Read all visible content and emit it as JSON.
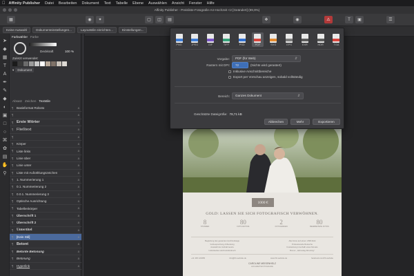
{
  "menubar": {
    "app_name": "Affinity Publisher",
    "items": [
      "Datei",
      "Bearbeiten",
      "Dokument",
      "Text",
      "Tabelle",
      "Ebene",
      "Auswählen",
      "Ansicht",
      "Fenster",
      "Hilfe"
    ]
  },
  "window": {
    "title": "Affinity Publisher - Preisliste-Fotografie-A4-Hochzeit <2 [Geändert] (99,9%)"
  },
  "context_toolbar": {
    "buttons": [
      "Keine Auswahl",
      "Dokumenteinstellungen...",
      "Layoutstile einrichten...",
      "Einstellungen..."
    ]
  },
  "color_panel": {
    "tabs": [
      "Farbwähler",
      "Farbe"
    ],
    "opacity_label": "Deckkraft",
    "opacity_value": "100 %",
    "recent_label": "Zuletzt verwendet:",
    "document_label": "Dokument",
    "recent_colors": [
      "#1b1b1b",
      "#3a3a3a",
      "#6b6b6b",
      "#9b9b9b",
      "#c8c8c8",
      "#ffffff",
      "#b8a99a",
      "#7f7268",
      "#c9c2ba",
      "#dedad4"
    ]
  },
  "text_styles_panel": {
    "tabs": [
      "Absatz",
      "Zeichen",
      "Textstile"
    ],
    "styles": [
      "Basisformat Roboto",
      "",
      "Erste Wörter",
      "Fließtext",
      "",
      "Körper",
      "Liste links",
      "Linie über",
      "Linie unter",
      "Liste mit Aufzählungszeichen",
      "1. Nummerierung 1",
      "0.1. Nummerierung 2",
      "0.0.1. Nummerierung 3",
      "Optische Ausrichtung",
      "Tabellenkörper",
      "Überschrift 1",
      "Überschrift 2",
      "Untertitel",
      "[Kein Stil]",
      "Betont",
      "Betonte Betonung",
      "Betonung",
      "Hyperlink"
    ],
    "selected_index": 18
  },
  "export_dialog": {
    "formats": [
      "PNG",
      "JPEG",
      "GIF",
      "TIFF",
      "PSD",
      "PDF",
      "SVG",
      "EPS",
      "EXR",
      "HDR",
      "TGA"
    ],
    "selected_format": "PDF",
    "format_colors": [
      "#3f7fd8",
      "#3f7fd8",
      "#7a55c9",
      "#37a37a",
      "#2f6fd0",
      "#d9453d",
      "#e38b2f",
      "#7a7a7a",
      "#5b5b5b",
      "#5b5b5b",
      "#d9453d"
    ],
    "preset_label": "Vorgabe:",
    "preset_value": "PDF (für Web)",
    "raster_label": "Rastern mit DPI:",
    "raster_value": "72",
    "raster_note": "(Nichts wird gerastert)",
    "checkbox_bleed": "Inklusive Anschnittbereiche",
    "checkbox_preview": "Export per Vorschau anzeigen, sobald vollständig",
    "area_label": "Bereich:",
    "area_value": "Ganzes Dokument",
    "filesize_label": "Geschätzte Dateigröße:",
    "filesize_value": "78,71 kB",
    "buttons": [
      "Abbrechen",
      "Mehr",
      "Exportieren"
    ]
  },
  "document_page": {
    "price_badge": "1000 €",
    "headline": "GOLD: LASSEN SIE SICH FOTOGRAFISCH VERWÖHNEN.",
    "stats": [
      {
        "number": "8",
        "label": "STUNDEN"
      },
      {
        "number": "80",
        "label": "FOTO-MOTIVE"
      },
      {
        "number": "2",
        "label": "FOTOGRAFEN"
      },
      {
        "number": "80",
        "label": "BEARBEITETE FOTOS"
      }
    ],
    "features_left": [
      "Begleitung des gesamten Hochzeitstags",
      "Vorbesprechung & Beratung",
      "Auswahl der Aufnahmeorte",
      "Individuelles Hochzeitsfotobuch"
    ],
    "features_right": [
      "Alle Fotos auf einem USB-Stick",
      "Professionelle Retusche",
      "Fotoleistung innerhalb eines Monats",
      "Bonus: „Jahrestag-Shooting\""
    ],
    "contacts": [
      "+11 345 123456",
      "info@hb-website.de",
      "www.hb-website.de",
      "facebook.com/hb-website"
    ],
    "owner_name": "CAROLINE MEISENHELZ",
    "owner_subtitle": "HOCHZEITSFOTOGRAFIE"
  }
}
